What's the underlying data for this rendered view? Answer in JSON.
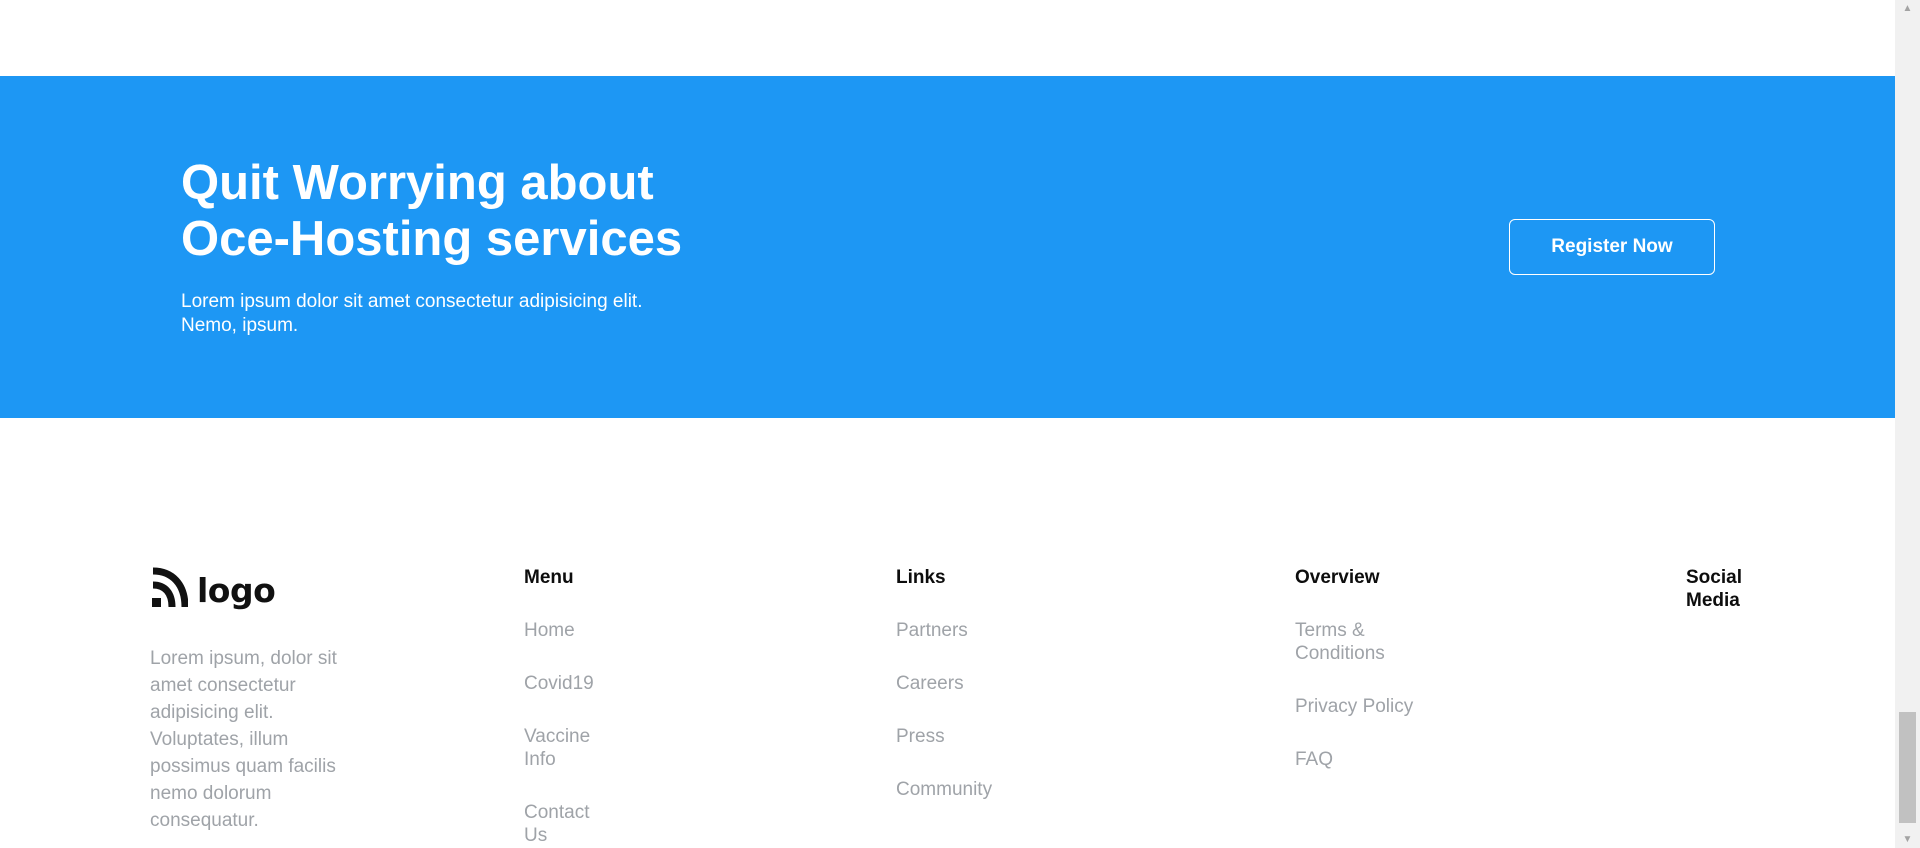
{
  "cta": {
    "title_line1": "Quit Worrying about",
    "title_line2": "Oce-Hosting services",
    "desc_line1": "Lorem ipsum dolor sit amet consectetur adipisicing elit.",
    "desc_line2": "Nemo, ipsum.",
    "button_label": "Register Now",
    "background_color": "#1d97f4"
  },
  "footer": {
    "logo_text": "logo",
    "brand_description": "Lorem ipsum, dolor sit amet consectetur adipisicing elit. Voluptates, illum possimus quam facilis nemo dolorum consequatur.",
    "menu": {
      "title": "Menu",
      "items": [
        "Home",
        "Covid19",
        "Vaccine Info",
        "Contact Us"
      ]
    },
    "links": {
      "title": "Links",
      "items": [
        "Partners",
        "Careers",
        "Press",
        "Community"
      ]
    },
    "overview": {
      "title": "Overview",
      "items": [
        "Terms & Conditions",
        "Privacy Policy",
        "FAQ"
      ]
    },
    "social": {
      "title": "Social Media"
    }
  },
  "scrollbar": {
    "up_icon": "triangle-up-icon",
    "down_icon": "triangle-down-icon"
  }
}
